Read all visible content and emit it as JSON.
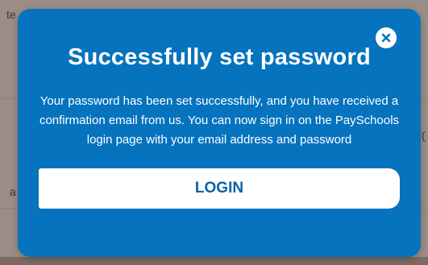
{
  "background": {
    "top_fragment": "te",
    "left_fragment": "a",
    "right_fragment": "("
  },
  "modal": {
    "title": "Successfully set password",
    "message": "Your password has been set successfully, and you have received a confirmation email from us. You can now sign in on the PaySchools login page with your email address and password",
    "login_label": "LOGIN",
    "close_icon": "close-icon"
  },
  "colors": {
    "modal_bg": "#0573bd",
    "button_text": "#0b62a8",
    "backdrop": "#9a8d87"
  }
}
